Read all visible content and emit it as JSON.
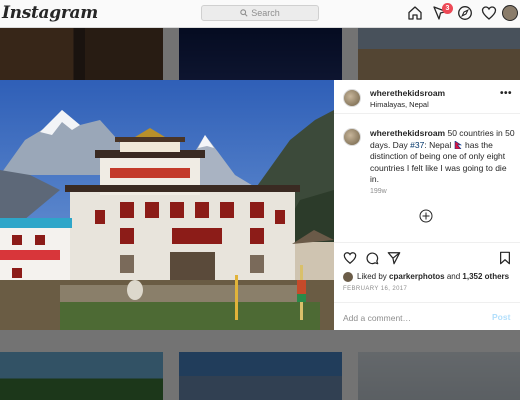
{
  "app": {
    "name": "Instagram"
  },
  "nav": {
    "search_placeholder": "Search",
    "notification_count": "3"
  },
  "post": {
    "username": "wherethekidsroam",
    "location": "Himalayas, Nepal",
    "caption_user": "wherethekidsroam",
    "caption_pre": " 50 countries in 50 days. Day ",
    "caption_tag": "#37",
    "caption_mid": ": Nepal ",
    "caption_post": " has the distinction of being one of only eight countries I felt like I was going to die in.",
    "age": "199w",
    "liked_prefix": "Liked by ",
    "liked_user": "cparkerphotos",
    "liked_mid": " and ",
    "liked_count": "1,352 others",
    "date": "FEBRUARY 16, 2017",
    "comment_placeholder": "Add a comment…",
    "post_label": "Post"
  },
  "colors": {
    "link": "#003569",
    "post_disabled": "#b2dffc",
    "badge": "#ed4956",
    "muted": "#8e8e8e"
  },
  "icons": {
    "nav": [
      "home-icon",
      "activity-icon",
      "explore-icon",
      "heart-icon"
    ],
    "actions": [
      "like-icon",
      "comment-icon",
      "share-icon",
      "save-icon"
    ]
  }
}
